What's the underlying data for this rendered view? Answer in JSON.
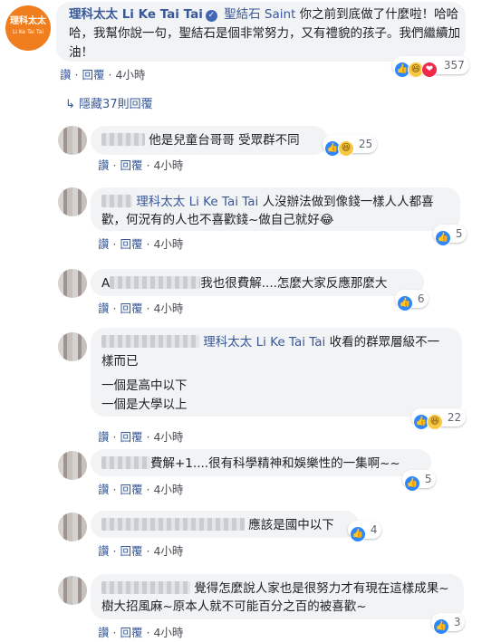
{
  "main_comment": {
    "avatar_line1": "理科太太",
    "avatar_line2": "Li Ke Tai Tai",
    "author": "理科太太 Li Ke Tai Tai",
    "verified_icon": "✓",
    "tagged_name": "聖結石 Saint",
    "text": "你之前到底做了什麼啦！哈哈哈，我幫你說一句，聖結石是個非常努力，又有禮貌的孩子。我們繼續加油！",
    "like_label": "讚",
    "reply_label": "回覆",
    "time": "4小時",
    "reaction_count": "357"
  },
  "hidden_replies": {
    "icon": "↳",
    "label": "隱藏37則回覆"
  },
  "replies": [
    {
      "text": "他是兒童台哥哥 受眾群不同",
      "like_label": "讚",
      "reply_label": "回覆",
      "time": "4小時",
      "reaction_count": "25"
    },
    {
      "tagged_name": "理科太太 Li Ke Tai Tai",
      "text": "人沒辦法做到像錢一樣人人都喜歡，何況有的人也不喜歡錢~做自己就好😂",
      "like_label": "讚",
      "reply_label": "回覆",
      "time": "4小時",
      "reaction_count": "5"
    },
    {
      "prefix": "A",
      "text": "我也很費解....怎麼大家反應那麼大",
      "like_label": "讚",
      "reply_label": "回覆",
      "time": "4小時",
      "reaction_count": "6"
    },
    {
      "tagged_name": "理科太太 Li Ke Tai Tai",
      "text_line1": "收看的群眾層級不一樣而已",
      "text_line2": "一個是高中以下",
      "text_line3": "一個是大學以上",
      "like_label": "讚",
      "reply_label": "回覆",
      "time": "4小時",
      "reaction_count": "22"
    },
    {
      "text": "費解+1....很有科學精神和娛樂性的一集啊~~",
      "like_label": "讚",
      "reply_label": "回覆",
      "time": "4小時",
      "reaction_count": "5"
    },
    {
      "text": "應該是國中以下",
      "like_label": "讚",
      "reply_label": "回覆",
      "time": "4小時",
      "reaction_count": "4"
    },
    {
      "text": "覺得怎麼說人家也是很努力才有現在這樣成果~樹大招風麻~原本人就不可能百分之百的被喜歡~",
      "like_label": "讚",
      "reply_label": "回覆",
      "time": "4小時",
      "reaction_count": "3"
    }
  ],
  "icons": {
    "like": "👍",
    "haha": "😆",
    "love": "❤",
    "separator": "·"
  },
  "colors": {
    "link": "#385898",
    "bubble": "#f2f3f5",
    "like": "#2d88ff"
  }
}
